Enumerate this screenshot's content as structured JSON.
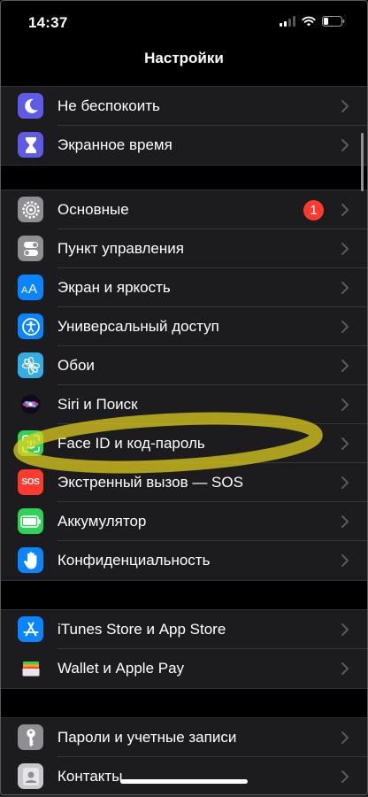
{
  "status_bar": {
    "time": "14:37"
  },
  "nav": {
    "title": "Настройки"
  },
  "groups": [
    {
      "items": [
        {
          "label": "Не беспокоить",
          "icon": "moon-icon",
          "color": "#5e5ce6"
        },
        {
          "label": "Экранное время",
          "icon": "hourglass-icon",
          "color": "#5e5ce6"
        }
      ]
    },
    {
      "items": [
        {
          "label": "Основные",
          "icon": "gear-icon",
          "color": "#8e8e93",
          "badge": "1"
        },
        {
          "label": "Пункт управления",
          "icon": "toggles-icon",
          "color": "#8e8e93"
        },
        {
          "label": "Экран и яркость",
          "icon": "text-size-icon",
          "color": "#0a84ff"
        },
        {
          "label": "Универсальный доступ",
          "icon": "accessibility-icon",
          "color": "#0a84ff"
        },
        {
          "label": "Обои",
          "icon": "flower-icon",
          "color": "#32ade6"
        },
        {
          "label": "Siri и Поиск",
          "icon": "siri-icon",
          "color": "#1c1c1e"
        },
        {
          "label": "Face ID и код-пароль",
          "icon": "face-id-icon",
          "color": "#30d158"
        },
        {
          "label": "Экстренный вызов — SOS",
          "icon": "sos-icon",
          "color": "#ff3b30",
          "icon_text": "SOS"
        },
        {
          "label": "Аккумулятор",
          "icon": "battery-icon",
          "color": "#30d158"
        },
        {
          "label": "Конфиденциальность",
          "icon": "hand-icon",
          "color": "#0a84ff"
        }
      ]
    },
    {
      "items": [
        {
          "label": "iTunes Store и App Store",
          "icon": "app-store-icon",
          "color": "#0a84ff"
        },
        {
          "label": "Wallet и Apple Pay",
          "icon": "wallet-icon",
          "color": "#1c1c1e"
        }
      ]
    },
    {
      "items": [
        {
          "label": "Пароли и учетные записи",
          "icon": "key-icon",
          "color": "#8e8e93"
        },
        {
          "label": "Контакты",
          "icon": "contacts-icon",
          "color": "#c7c7cc"
        }
      ]
    }
  ],
  "highlight_color": "#e6d21e"
}
